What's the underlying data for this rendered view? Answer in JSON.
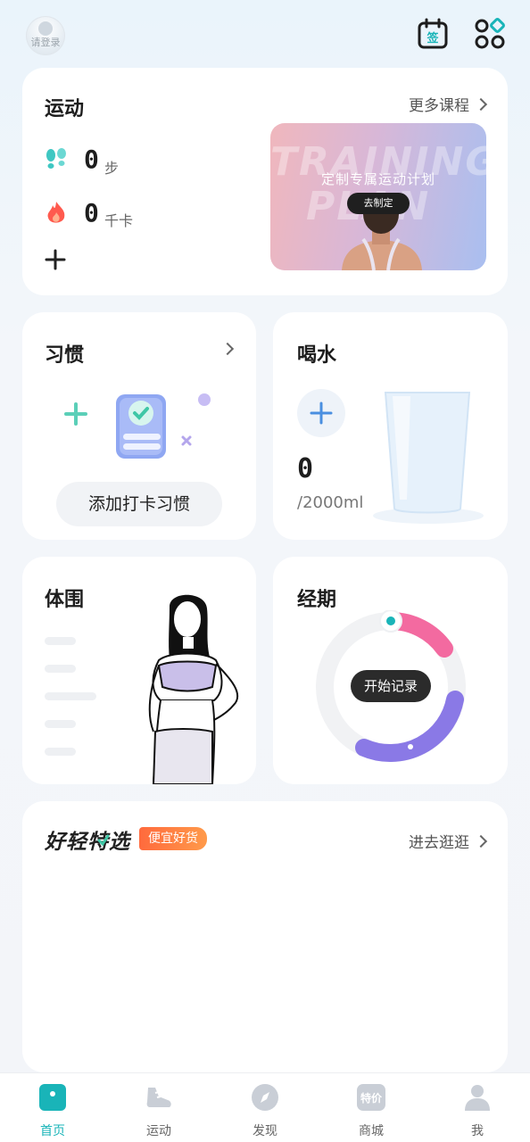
{
  "header": {
    "avatar_label": "请登录",
    "checkin_icon_label": "签"
  },
  "sport": {
    "title": "运动",
    "more_label": "更多课程",
    "steps_value": "0",
    "steps_unit": "步",
    "calories_value": "0",
    "calories_unit": "千卡",
    "banner": {
      "bg_text_1": "TRAINING",
      "bg_text_2": "PLAN",
      "title": "定制专属运动计划",
      "button": "去制定"
    }
  },
  "habit": {
    "title": "习惯",
    "button": "添加打卡习惯"
  },
  "water": {
    "title": "喝水",
    "value": "0",
    "goal": "/2000ml"
  },
  "body": {
    "title": "体围"
  },
  "period": {
    "title": "经期",
    "button": "开始记录"
  },
  "selection": {
    "title": "好轻特选",
    "badge": "便宜好货",
    "more_label": "进去逛逛"
  },
  "tabbar": {
    "tabs": [
      {
        "label": "首页",
        "active": true
      },
      {
        "label": "运动",
        "active": false
      },
      {
        "label": "发现",
        "active": false
      },
      {
        "label": "商城",
        "active": false,
        "icon_text": "特价"
      },
      {
        "label": "我",
        "active": false
      }
    ]
  },
  "colors": {
    "accent": "#19b4b8",
    "period_pink": "#f36aa0",
    "period_purple": "#8a79e6",
    "badge_orange": "#ff7a3d"
  }
}
